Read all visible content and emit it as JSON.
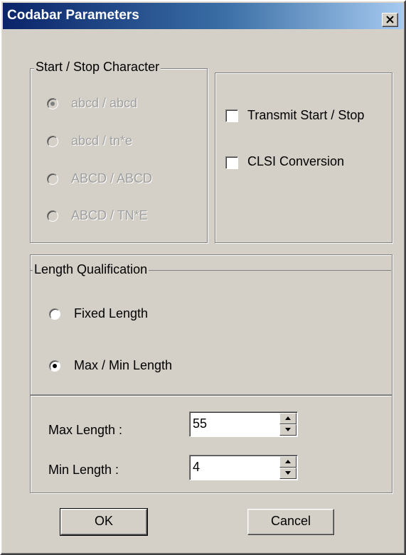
{
  "window": {
    "title": "Codabar Parameters",
    "close_label": "X"
  },
  "start_stop": {
    "legend": "Start / Stop Character",
    "options": [
      {
        "label": "abcd / abcd",
        "selected": true
      },
      {
        "label": "abcd / tn*e",
        "selected": false
      },
      {
        "label": "ABCD / ABCD",
        "selected": false
      },
      {
        "label": "ABCD / TN*E",
        "selected": false
      }
    ],
    "enabled": false
  },
  "options_group": {
    "transmit_label": "Transmit Start / Stop",
    "transmit_checked": false,
    "clsi_label": "CLSI Conversion",
    "clsi_checked": false
  },
  "length_qualification": {
    "legend": "Length Qualification",
    "fixed_label": "Fixed Length",
    "fixed_selected": false,
    "maxmin_label": "Max / Min Length",
    "maxmin_selected": true
  },
  "lengths": {
    "max_label": "Max Length :",
    "max_value": "55",
    "min_label": "Min Length :",
    "min_value": "4"
  },
  "buttons": {
    "ok": "OK",
    "cancel": "Cancel"
  }
}
